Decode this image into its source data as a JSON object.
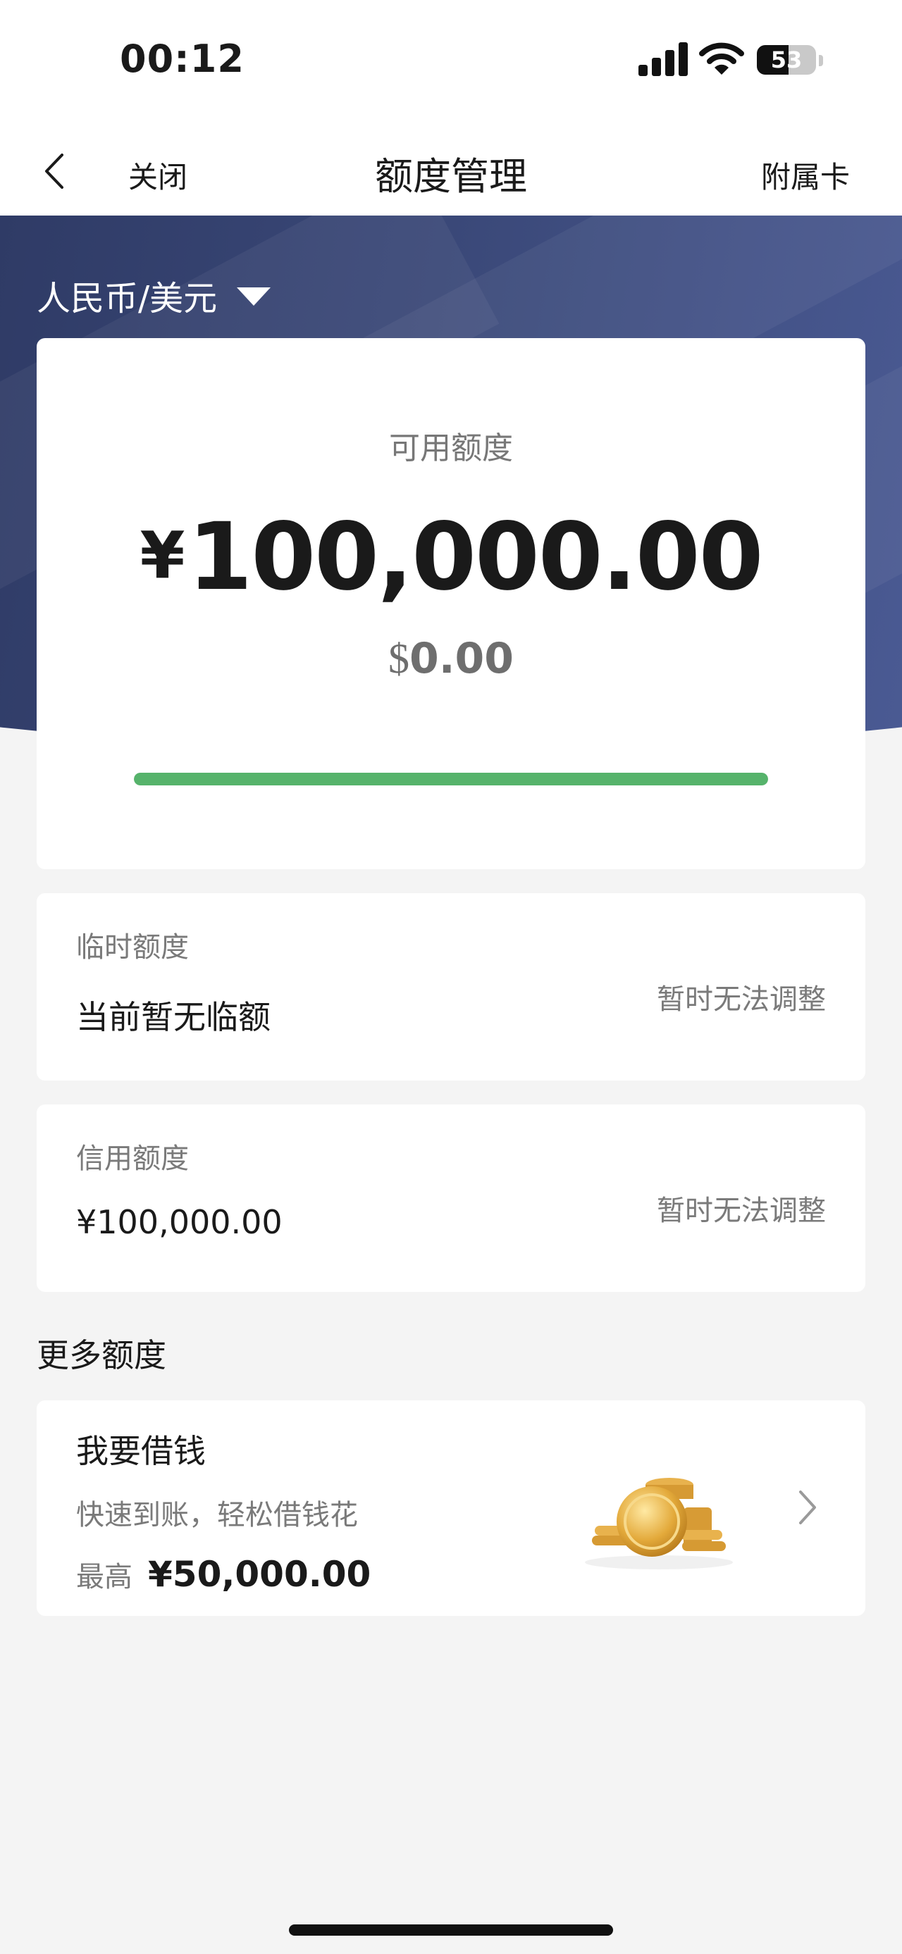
{
  "status_bar": {
    "time": "00:12",
    "battery": "53",
    "icons": [
      "signal-icon",
      "wifi-icon",
      "battery-icon"
    ]
  },
  "nav": {
    "back_icon": "chevron-left-icon",
    "close_label": "关闭",
    "title": "额度管理",
    "right_action": "附属卡"
  },
  "hero": {
    "currency_selector": "人民币/美元",
    "caret_icon": "caret-down-icon",
    "colors": {
      "from": "#2f3b66",
      "to": "#4a5a93"
    }
  },
  "available": {
    "label": "可用额度",
    "cny_symbol": "¥",
    "cny_value": "100,000.00",
    "usd_symbol": "$",
    "usd_value": "0.00",
    "progress_fraction": 1.0,
    "progress_color": "#56b36b"
  },
  "temp_limit": {
    "title": "临时额度",
    "value": "当前暂无临额",
    "action": "暂时无法调整"
  },
  "credit_limit": {
    "title": "信用额度",
    "value": "¥100,000.00",
    "action": "暂时无法调整"
  },
  "more": {
    "section_title": "更多额度",
    "loan": {
      "title": "我要借钱",
      "description": "快速到账，轻松借钱花",
      "max_label": "最高",
      "max_value": "¥50,000.00",
      "icon": "gold-coins-icon",
      "arrow_icon": "chevron-right-icon"
    }
  }
}
